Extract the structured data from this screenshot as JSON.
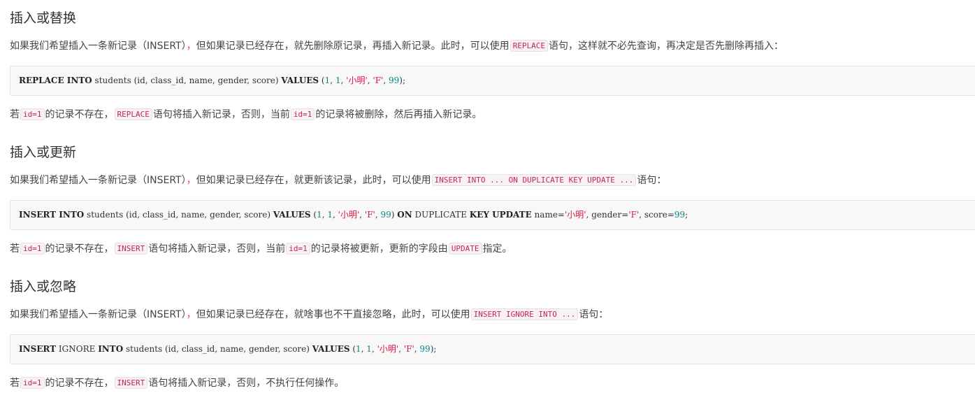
{
  "s1": {
    "title": "插入或替换",
    "intro_a": "如果我们希望插入一条新记录（INSERT）",
    "intro_comma": "，",
    "intro_b": "但如果记录已经存在，就先删除原记录，再插入新记录。此时，可以使用",
    "intro_code": "REPLACE",
    "intro_c": "语句，这样就不必先查询，再决定是否先删除再插入：",
    "code": {
      "kw1": "REPLACE INTO",
      "rest1": " students (id, class_id, name, gender, score) ",
      "kw2": "VALUES",
      "p1": " (",
      "n1": "1",
      "p2": ", ",
      "n2": "1",
      "p3": ", ",
      "s1": "'小明'",
      "p4": ", ",
      "s2": "'F'",
      "p5": ", ",
      "n3": "99",
      "p6": ");"
    },
    "note_a": "若",
    "note_code1": "id=1",
    "note_b": "的记录不存在，",
    "note_code2": "REPLACE",
    "note_c": "语句将插入新记录，否则，当前",
    "note_code3": "id=1",
    "note_d": "的记录将被删除，然后再插入新记录。"
  },
  "s2": {
    "title": "插入或更新",
    "intro_a": "如果我们希望插入一条新记录（INSERT）",
    "intro_comma": "，",
    "intro_b": "但如果记录已经存在，就更新该记录，此时，可以使用",
    "intro_code": "INSERT INTO ... ON DUPLICATE KEY UPDATE ...",
    "intro_c": "语句：",
    "code": {
      "kw1": "INSERT INTO",
      "rest1": " students (id, class_id, name, gender, score) ",
      "kw2": "VALUES",
      "p1": " (",
      "n1": "1",
      "p2": ", ",
      "n2": "1",
      "p3": ", ",
      "s1": "'小明'",
      "p4": ", ",
      "s2": "'F'",
      "p5": ", ",
      "n3": "99",
      "p6": ") ",
      "kw3": "ON",
      "p7": " DUPLICATE ",
      "kw4": "KEY UPDATE",
      "p8": " name=",
      "s3": "'小明'",
      "p9": ", gender=",
      "s4": "'F'",
      "p10": ", score=",
      "n4": "99",
      "p11": ";"
    },
    "note_a": "若",
    "note_code1": "id=1",
    "note_b": "的记录不存在，",
    "note_code2": "INSERT",
    "note_c": "语句将插入新记录，否则，当前",
    "note_code3": "id=1",
    "note_d": "的记录将被更新，更新的字段由",
    "note_code4": "UPDATE",
    "note_e": "指定。"
  },
  "s3": {
    "title": "插入或忽略",
    "intro_a": "如果我们希望插入一条新记录（INSERT）",
    "intro_comma": "，",
    "intro_b": "但如果记录已经存在，就啥事也不干直接忽略，此时，可以使用",
    "intro_code": "INSERT IGNORE INTO ...",
    "intro_c": "语句：",
    "code": {
      "kw1": "INSERT",
      "p0": " IGNORE ",
      "kw1b": "INTO",
      "rest1": " students (id, class_id, name, gender, score) ",
      "kw2": "VALUES",
      "p1": " (",
      "n1": "1",
      "p2": ", ",
      "n2": "1",
      "p3": ", ",
      "s1": "'小明'",
      "p4": ", ",
      "s2": "'F'",
      "p5": ", ",
      "n3": "99",
      "p6": ");"
    },
    "note_a": "若",
    "note_code1": "id=1",
    "note_b": "的记录不存在，",
    "note_code2": "INSERT",
    "note_c": "语句将插入新记录，否则，不执行任何操作。"
  }
}
